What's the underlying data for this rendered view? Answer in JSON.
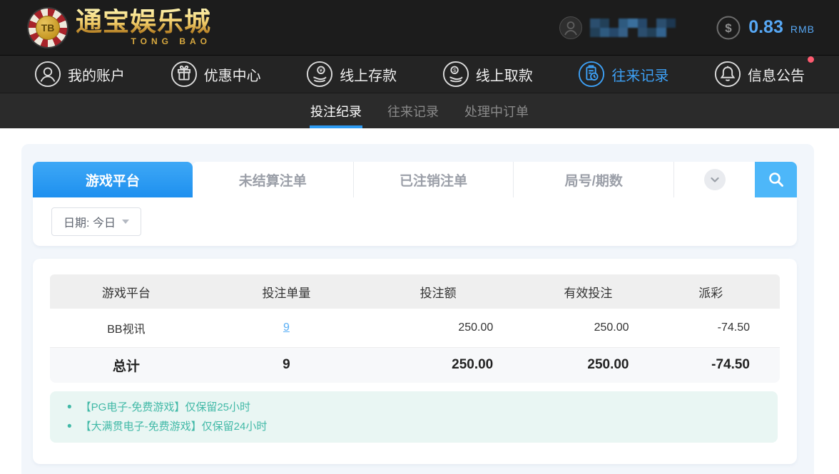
{
  "header": {
    "logo": {
      "chip_text": "TB",
      "brand_cn": "通宝娱乐城",
      "brand_en": "TONG BAO"
    },
    "user": {
      "username_masked": true
    },
    "balance": {
      "amount": "0.83",
      "currency": "RMB",
      "icon": "dollar-circle"
    }
  },
  "nav": {
    "items": [
      {
        "label": "我的账户",
        "icon": "user-circle",
        "active": false
      },
      {
        "label": "优惠中心",
        "icon": "gift-circle",
        "active": false
      },
      {
        "label": "线上存款",
        "icon": "deposit-hand-coin",
        "active": false
      },
      {
        "label": "线上取款",
        "icon": "withdraw-hand-coin",
        "active": false
      },
      {
        "label": "往来记录",
        "icon": "clipboard-clock",
        "active": true
      },
      {
        "label": "信息公告",
        "icon": "bell",
        "active": false,
        "badge": "red-dot"
      }
    ]
  },
  "subnav": {
    "items": [
      {
        "label": "投注纪录",
        "active": true
      },
      {
        "label": "往来记录",
        "active": false
      },
      {
        "label": "处理中订单",
        "active": false
      }
    ]
  },
  "filters": {
    "tabs": [
      {
        "label": "游戏平台",
        "active": true
      },
      {
        "label": "未结算注单",
        "active": false
      },
      {
        "label": "已注销注单",
        "active": false
      },
      {
        "label": "局号/期数",
        "active": false
      }
    ],
    "expand_icon": "chevron-down",
    "search_icon": "magnifier",
    "date_label": "日期: 今日"
  },
  "table": {
    "columns": [
      "游戏平台",
      "投注单量",
      "投注额",
      "有效投注",
      "派彩"
    ],
    "rows": [
      {
        "platform": "BB视讯",
        "count": "9",
        "bet_amount": "250.00",
        "valid_bet": "250.00",
        "payout": "-74.50"
      }
    ],
    "total": {
      "label": "总计",
      "count": "9",
      "bet_amount": "250.00",
      "valid_bet": "250.00",
      "payout": "-74.50"
    }
  },
  "notes": [
    "【PG电子-免费游戏】仅保留25小时",
    "【大满贯电子-免费游戏】仅保留24小时"
  ],
  "colors": {
    "accent_blue": "#2e9bf2",
    "search_blue": "#4db7f9",
    "negative_red": "#f2547e",
    "note_teal": "#41b9a7",
    "gold": "#e8c25a",
    "balance_blue": "#57a8f5",
    "badge_red": "#ff5b70"
  }
}
